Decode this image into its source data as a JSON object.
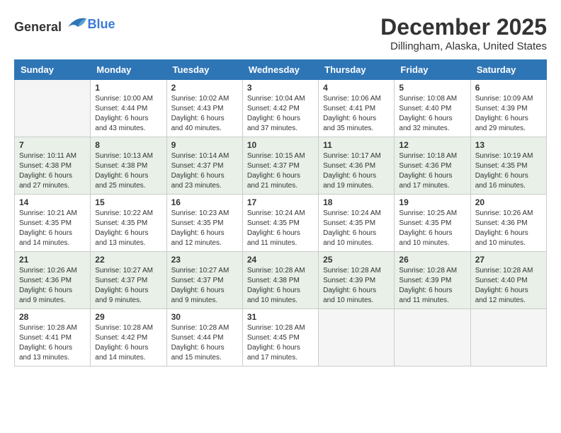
{
  "logo": {
    "general": "General",
    "blue": "Blue"
  },
  "header": {
    "month": "December 2025",
    "location": "Dillingham, Alaska, United States"
  },
  "weekdays": [
    "Sunday",
    "Monday",
    "Tuesday",
    "Wednesday",
    "Thursday",
    "Friday",
    "Saturday"
  ],
  "weeks": [
    [
      {
        "day": "",
        "empty": true
      },
      {
        "day": "1",
        "sunrise": "Sunrise: 10:00 AM",
        "sunset": "Sunset: 4:44 PM",
        "daylight": "Daylight: 6 hours and 43 minutes."
      },
      {
        "day": "2",
        "sunrise": "Sunrise: 10:02 AM",
        "sunset": "Sunset: 4:43 PM",
        "daylight": "Daylight: 6 hours and 40 minutes."
      },
      {
        "day": "3",
        "sunrise": "Sunrise: 10:04 AM",
        "sunset": "Sunset: 4:42 PM",
        "daylight": "Daylight: 6 hours and 37 minutes."
      },
      {
        "day": "4",
        "sunrise": "Sunrise: 10:06 AM",
        "sunset": "Sunset: 4:41 PM",
        "daylight": "Daylight: 6 hours and 35 minutes."
      },
      {
        "day": "5",
        "sunrise": "Sunrise: 10:08 AM",
        "sunset": "Sunset: 4:40 PM",
        "daylight": "Daylight: 6 hours and 32 minutes."
      },
      {
        "day": "6",
        "sunrise": "Sunrise: 10:09 AM",
        "sunset": "Sunset: 4:39 PM",
        "daylight": "Daylight: 6 hours and 29 minutes."
      }
    ],
    [
      {
        "day": "7",
        "sunrise": "Sunrise: 10:11 AM",
        "sunset": "Sunset: 4:38 PM",
        "daylight": "Daylight: 6 hours and 27 minutes."
      },
      {
        "day": "8",
        "sunrise": "Sunrise: 10:13 AM",
        "sunset": "Sunset: 4:38 PM",
        "daylight": "Daylight: 6 hours and 25 minutes."
      },
      {
        "day": "9",
        "sunrise": "Sunrise: 10:14 AM",
        "sunset": "Sunset: 4:37 PM",
        "daylight": "Daylight: 6 hours and 23 minutes."
      },
      {
        "day": "10",
        "sunrise": "Sunrise: 10:15 AM",
        "sunset": "Sunset: 4:37 PM",
        "daylight": "Daylight: 6 hours and 21 minutes."
      },
      {
        "day": "11",
        "sunrise": "Sunrise: 10:17 AM",
        "sunset": "Sunset: 4:36 PM",
        "daylight": "Daylight: 6 hours and 19 minutes."
      },
      {
        "day": "12",
        "sunrise": "Sunrise: 10:18 AM",
        "sunset": "Sunset: 4:36 PM",
        "daylight": "Daylight: 6 hours and 17 minutes."
      },
      {
        "day": "13",
        "sunrise": "Sunrise: 10:19 AM",
        "sunset": "Sunset: 4:35 PM",
        "daylight": "Daylight: 6 hours and 16 minutes."
      }
    ],
    [
      {
        "day": "14",
        "sunrise": "Sunrise: 10:21 AM",
        "sunset": "Sunset: 4:35 PM",
        "daylight": "Daylight: 6 hours and 14 minutes."
      },
      {
        "day": "15",
        "sunrise": "Sunrise: 10:22 AM",
        "sunset": "Sunset: 4:35 PM",
        "daylight": "Daylight: 6 hours and 13 minutes."
      },
      {
        "day": "16",
        "sunrise": "Sunrise: 10:23 AM",
        "sunset": "Sunset: 4:35 PM",
        "daylight": "Daylight: 6 hours and 12 minutes."
      },
      {
        "day": "17",
        "sunrise": "Sunrise: 10:24 AM",
        "sunset": "Sunset: 4:35 PM",
        "daylight": "Daylight: 6 hours and 11 minutes."
      },
      {
        "day": "18",
        "sunrise": "Sunrise: 10:24 AM",
        "sunset": "Sunset: 4:35 PM",
        "daylight": "Daylight: 6 hours and 10 minutes."
      },
      {
        "day": "19",
        "sunrise": "Sunrise: 10:25 AM",
        "sunset": "Sunset: 4:35 PM",
        "daylight": "Daylight: 6 hours and 10 minutes."
      },
      {
        "day": "20",
        "sunrise": "Sunrise: 10:26 AM",
        "sunset": "Sunset: 4:36 PM",
        "daylight": "Daylight: 6 hours and 10 minutes."
      }
    ],
    [
      {
        "day": "21",
        "sunrise": "Sunrise: 10:26 AM",
        "sunset": "Sunset: 4:36 PM",
        "daylight": "Daylight: 6 hours and 9 minutes."
      },
      {
        "day": "22",
        "sunrise": "Sunrise: 10:27 AM",
        "sunset": "Sunset: 4:37 PM",
        "daylight": "Daylight: 6 hours and 9 minutes."
      },
      {
        "day": "23",
        "sunrise": "Sunrise: 10:27 AM",
        "sunset": "Sunset: 4:37 PM",
        "daylight": "Daylight: 6 hours and 9 minutes."
      },
      {
        "day": "24",
        "sunrise": "Sunrise: 10:28 AM",
        "sunset": "Sunset: 4:38 PM",
        "daylight": "Daylight: 6 hours and 10 minutes."
      },
      {
        "day": "25",
        "sunrise": "Sunrise: 10:28 AM",
        "sunset": "Sunset: 4:39 PM",
        "daylight": "Daylight: 6 hours and 10 minutes."
      },
      {
        "day": "26",
        "sunrise": "Sunrise: 10:28 AM",
        "sunset": "Sunset: 4:39 PM",
        "daylight": "Daylight: 6 hours and 11 minutes."
      },
      {
        "day": "27",
        "sunrise": "Sunrise: 10:28 AM",
        "sunset": "Sunset: 4:40 PM",
        "daylight": "Daylight: 6 hours and 12 minutes."
      }
    ],
    [
      {
        "day": "28",
        "sunrise": "Sunrise: 10:28 AM",
        "sunset": "Sunset: 4:41 PM",
        "daylight": "Daylight: 6 hours and 13 minutes."
      },
      {
        "day": "29",
        "sunrise": "Sunrise: 10:28 AM",
        "sunset": "Sunset: 4:42 PM",
        "daylight": "Daylight: 6 hours and 14 minutes."
      },
      {
        "day": "30",
        "sunrise": "Sunrise: 10:28 AM",
        "sunset": "Sunset: 4:44 PM",
        "daylight": "Daylight: 6 hours and 15 minutes."
      },
      {
        "day": "31",
        "sunrise": "Sunrise: 10:28 AM",
        "sunset": "Sunset: 4:45 PM",
        "daylight": "Daylight: 6 hours and 17 minutes."
      },
      {
        "day": "",
        "empty": true
      },
      {
        "day": "",
        "empty": true
      },
      {
        "day": "",
        "empty": true
      }
    ]
  ]
}
